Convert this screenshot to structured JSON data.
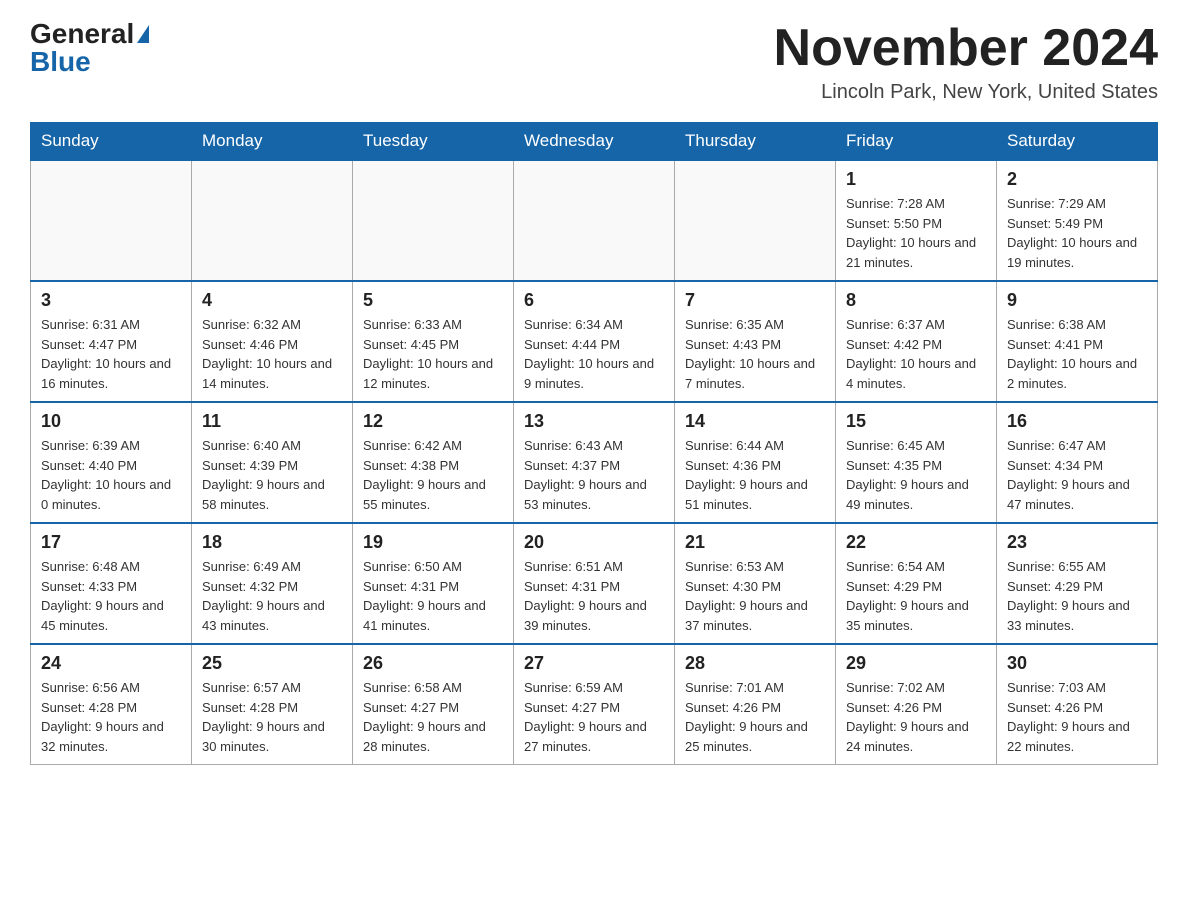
{
  "header": {
    "logo_general": "General",
    "logo_blue": "Blue",
    "month_title": "November 2024",
    "location": "Lincoln Park, New York, United States"
  },
  "weekdays": [
    "Sunday",
    "Monday",
    "Tuesday",
    "Wednesday",
    "Thursday",
    "Friday",
    "Saturday"
  ],
  "weeks": [
    [
      {
        "day": "",
        "info": ""
      },
      {
        "day": "",
        "info": ""
      },
      {
        "day": "",
        "info": ""
      },
      {
        "day": "",
        "info": ""
      },
      {
        "day": "",
        "info": ""
      },
      {
        "day": "1",
        "info": "Sunrise: 7:28 AM\nSunset: 5:50 PM\nDaylight: 10 hours and 21 minutes."
      },
      {
        "day": "2",
        "info": "Sunrise: 7:29 AM\nSunset: 5:49 PM\nDaylight: 10 hours and 19 minutes."
      }
    ],
    [
      {
        "day": "3",
        "info": "Sunrise: 6:31 AM\nSunset: 4:47 PM\nDaylight: 10 hours and 16 minutes."
      },
      {
        "day": "4",
        "info": "Sunrise: 6:32 AM\nSunset: 4:46 PM\nDaylight: 10 hours and 14 minutes."
      },
      {
        "day": "5",
        "info": "Sunrise: 6:33 AM\nSunset: 4:45 PM\nDaylight: 10 hours and 12 minutes."
      },
      {
        "day": "6",
        "info": "Sunrise: 6:34 AM\nSunset: 4:44 PM\nDaylight: 10 hours and 9 minutes."
      },
      {
        "day": "7",
        "info": "Sunrise: 6:35 AM\nSunset: 4:43 PM\nDaylight: 10 hours and 7 minutes."
      },
      {
        "day": "8",
        "info": "Sunrise: 6:37 AM\nSunset: 4:42 PM\nDaylight: 10 hours and 4 minutes."
      },
      {
        "day": "9",
        "info": "Sunrise: 6:38 AM\nSunset: 4:41 PM\nDaylight: 10 hours and 2 minutes."
      }
    ],
    [
      {
        "day": "10",
        "info": "Sunrise: 6:39 AM\nSunset: 4:40 PM\nDaylight: 10 hours and 0 minutes."
      },
      {
        "day": "11",
        "info": "Sunrise: 6:40 AM\nSunset: 4:39 PM\nDaylight: 9 hours and 58 minutes."
      },
      {
        "day": "12",
        "info": "Sunrise: 6:42 AM\nSunset: 4:38 PM\nDaylight: 9 hours and 55 minutes."
      },
      {
        "day": "13",
        "info": "Sunrise: 6:43 AM\nSunset: 4:37 PM\nDaylight: 9 hours and 53 minutes."
      },
      {
        "day": "14",
        "info": "Sunrise: 6:44 AM\nSunset: 4:36 PM\nDaylight: 9 hours and 51 minutes."
      },
      {
        "day": "15",
        "info": "Sunrise: 6:45 AM\nSunset: 4:35 PM\nDaylight: 9 hours and 49 minutes."
      },
      {
        "day": "16",
        "info": "Sunrise: 6:47 AM\nSunset: 4:34 PM\nDaylight: 9 hours and 47 minutes."
      }
    ],
    [
      {
        "day": "17",
        "info": "Sunrise: 6:48 AM\nSunset: 4:33 PM\nDaylight: 9 hours and 45 minutes."
      },
      {
        "day": "18",
        "info": "Sunrise: 6:49 AM\nSunset: 4:32 PM\nDaylight: 9 hours and 43 minutes."
      },
      {
        "day": "19",
        "info": "Sunrise: 6:50 AM\nSunset: 4:31 PM\nDaylight: 9 hours and 41 minutes."
      },
      {
        "day": "20",
        "info": "Sunrise: 6:51 AM\nSunset: 4:31 PM\nDaylight: 9 hours and 39 minutes."
      },
      {
        "day": "21",
        "info": "Sunrise: 6:53 AM\nSunset: 4:30 PM\nDaylight: 9 hours and 37 minutes."
      },
      {
        "day": "22",
        "info": "Sunrise: 6:54 AM\nSunset: 4:29 PM\nDaylight: 9 hours and 35 minutes."
      },
      {
        "day": "23",
        "info": "Sunrise: 6:55 AM\nSunset: 4:29 PM\nDaylight: 9 hours and 33 minutes."
      }
    ],
    [
      {
        "day": "24",
        "info": "Sunrise: 6:56 AM\nSunset: 4:28 PM\nDaylight: 9 hours and 32 minutes."
      },
      {
        "day": "25",
        "info": "Sunrise: 6:57 AM\nSunset: 4:28 PM\nDaylight: 9 hours and 30 minutes."
      },
      {
        "day": "26",
        "info": "Sunrise: 6:58 AM\nSunset: 4:27 PM\nDaylight: 9 hours and 28 minutes."
      },
      {
        "day": "27",
        "info": "Sunrise: 6:59 AM\nSunset: 4:27 PM\nDaylight: 9 hours and 27 minutes."
      },
      {
        "day": "28",
        "info": "Sunrise: 7:01 AM\nSunset: 4:26 PM\nDaylight: 9 hours and 25 minutes."
      },
      {
        "day": "29",
        "info": "Sunrise: 7:02 AM\nSunset: 4:26 PM\nDaylight: 9 hours and 24 minutes."
      },
      {
        "day": "30",
        "info": "Sunrise: 7:03 AM\nSunset: 4:26 PM\nDaylight: 9 hours and 22 minutes."
      }
    ]
  ]
}
